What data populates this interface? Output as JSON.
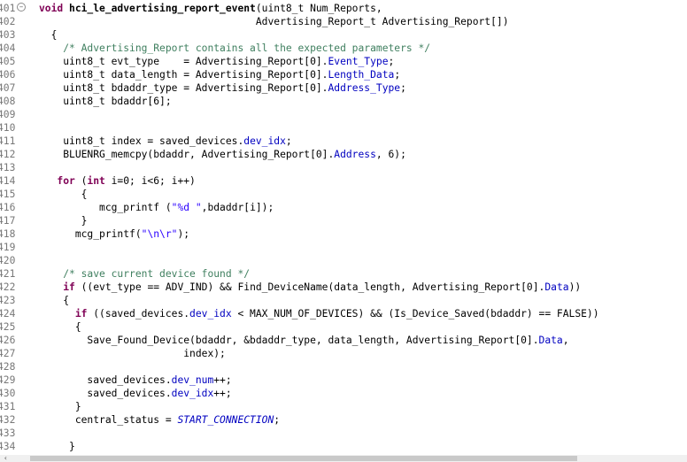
{
  "editor": {
    "lines": [
      {
        "n": "401",
        "fold": true,
        "indent": "",
        "parts": [
          [
            "kw",
            "void "
          ],
          [
            "b",
            "hci_le_advertising_report_event"
          ],
          [
            "",
            "(uint8_t Num_Reports,"
          ]
        ]
      },
      {
        "n": "402",
        "indent": "                                    ",
        "parts": [
          [
            "",
            "Advertising_Report_t Advertising_Report[])"
          ]
        ]
      },
      {
        "n": "403",
        "indent": "  ",
        "parts": [
          [
            "",
            "{"
          ]
        ]
      },
      {
        "n": "404",
        "indent": "    ",
        "parts": [
          [
            "cm",
            "/* Advertising_Report contains all the expected parameters */"
          ]
        ]
      },
      {
        "n": "405",
        "indent": "    ",
        "parts": [
          [
            "",
            "uint8_t evt_type    = Advertising_Report[0]."
          ],
          [
            "fld",
            "Event_Type"
          ],
          [
            "",
            ";"
          ]
        ]
      },
      {
        "n": "406",
        "indent": "    ",
        "parts": [
          [
            "",
            "uint8_t data_length = Advertising_Report[0]."
          ],
          [
            "fld",
            "Length_Data"
          ],
          [
            "",
            ";"
          ]
        ]
      },
      {
        "n": "407",
        "indent": "    ",
        "parts": [
          [
            "",
            "uint8_t bdaddr_type = Advertising_Report[0]."
          ],
          [
            "fld",
            "Address_Type"
          ],
          [
            "",
            ";"
          ]
        ]
      },
      {
        "n": "408",
        "indent": "    ",
        "parts": [
          [
            "",
            "uint8_t bdaddr[6];"
          ]
        ]
      },
      {
        "n": "409",
        "indent": "",
        "parts": []
      },
      {
        "n": "410",
        "indent": "",
        "parts": []
      },
      {
        "n": "411",
        "indent": "    ",
        "parts": [
          [
            "",
            "uint8_t index = saved_devices."
          ],
          [
            "fld",
            "dev_idx"
          ],
          [
            "",
            ";"
          ]
        ]
      },
      {
        "n": "412",
        "indent": "    ",
        "parts": [
          [
            "",
            "BLUENRG_memcpy(bdaddr, Advertising_Report[0]."
          ],
          [
            "fld",
            "Address"
          ],
          [
            "",
            ", 6);"
          ]
        ]
      },
      {
        "n": "413",
        "indent": "",
        "parts": []
      },
      {
        "n": "414",
        "indent": "   ",
        "parts": [
          [
            "kw",
            "for"
          ],
          [
            "",
            " ("
          ],
          [
            "kw",
            "int"
          ],
          [
            "",
            " i=0; i<6; i++)"
          ]
        ]
      },
      {
        "n": "415",
        "indent": "       ",
        "parts": [
          [
            "",
            "{"
          ]
        ]
      },
      {
        "n": "416",
        "indent": "          ",
        "parts": [
          [
            "",
            "mcg_printf ("
          ],
          [
            "str",
            "\"%d \""
          ],
          [
            "",
            ",bdaddr[i]);"
          ]
        ]
      },
      {
        "n": "417",
        "indent": "       ",
        "parts": [
          [
            "",
            "}"
          ]
        ]
      },
      {
        "n": "418",
        "indent": "      ",
        "parts": [
          [
            "",
            "mcg_printf("
          ],
          [
            "str",
            "\"\\n\\r\""
          ],
          [
            "",
            ");"
          ]
        ]
      },
      {
        "n": "419",
        "indent": "",
        "parts": []
      },
      {
        "n": "420",
        "indent": "",
        "parts": []
      },
      {
        "n": "421",
        "indent": "    ",
        "parts": [
          [
            "cm",
            "/* save current device found */"
          ]
        ]
      },
      {
        "n": "422",
        "indent": "    ",
        "parts": [
          [
            "kw",
            "if"
          ],
          [
            "",
            " ((evt_type == ADV_IND) && Find_DeviceName(data_length, Advertising_Report[0]."
          ],
          [
            "fld",
            "Data"
          ],
          [
            "",
            "))"
          ]
        ]
      },
      {
        "n": "423",
        "indent": "    ",
        "parts": [
          [
            "",
            "{"
          ]
        ]
      },
      {
        "n": "424",
        "indent": "      ",
        "parts": [
          [
            "kw",
            "if"
          ],
          [
            "",
            " ((saved_devices."
          ],
          [
            "fld",
            "dev_idx"
          ],
          [
            "",
            " < MAX_NUM_OF_DEVICES) && (Is_Device_Saved(bdaddr) == FALSE))"
          ]
        ]
      },
      {
        "n": "425",
        "indent": "      ",
        "parts": [
          [
            "",
            "{"
          ]
        ]
      },
      {
        "n": "426",
        "indent": "        ",
        "parts": [
          [
            "",
            "Save_Found_Device(bdaddr, &bdaddr_type, data_length, Advertising_Report[0]."
          ],
          [
            "fld",
            "Data"
          ],
          [
            "",
            ","
          ]
        ]
      },
      {
        "n": "427",
        "indent": "                        ",
        "parts": [
          [
            "",
            "index);"
          ]
        ]
      },
      {
        "n": "428",
        "indent": "",
        "parts": []
      },
      {
        "n": "429",
        "indent": "        ",
        "parts": [
          [
            "",
            "saved_devices."
          ],
          [
            "fld",
            "dev_num"
          ],
          [
            "",
            "++;"
          ]
        ]
      },
      {
        "n": "430",
        "indent": "        ",
        "parts": [
          [
            "",
            "saved_devices."
          ],
          [
            "fld",
            "dev_idx"
          ],
          [
            "",
            "++;"
          ]
        ]
      },
      {
        "n": "431",
        "indent": "      ",
        "parts": [
          [
            "",
            "}"
          ]
        ]
      },
      {
        "n": "432",
        "indent": "      ",
        "parts": [
          [
            "",
            "central_status = "
          ],
          [
            "const",
            "START_CONNECTION"
          ],
          [
            "",
            ";"
          ]
        ]
      },
      {
        "n": "433",
        "indent": "",
        "parts": []
      },
      {
        "n": "434",
        "indent": "     ",
        "parts": [
          [
            "",
            "}"
          ]
        ]
      }
    ]
  },
  "colors": {
    "keyword": "#7f0055",
    "comment": "#3f7f5f",
    "field": "#0000c0",
    "string": "#2a00ff"
  },
  "icons": {
    "fold": "fold-collapse-icon"
  }
}
